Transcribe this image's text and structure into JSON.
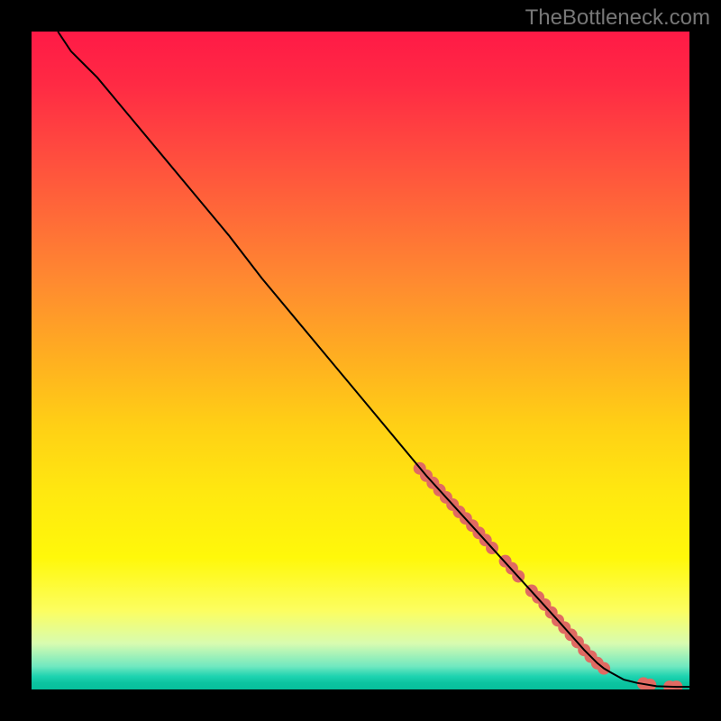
{
  "watermark": "TheBottleneck.com",
  "chart_data": {
    "type": "line",
    "title": "",
    "xlabel": "",
    "ylabel": "",
    "xlim": [
      0,
      100
    ],
    "ylim": [
      0,
      100
    ],
    "series": [
      {
        "name": "curve",
        "x": [
          4,
          6,
          8,
          10,
          15,
          20,
          25,
          30,
          35,
          40,
          45,
          50,
          55,
          60,
          65,
          70,
          75,
          80,
          84,
          86,
          87,
          88,
          90,
          92,
          95,
          98,
          100
        ],
        "values": [
          100,
          97,
          95,
          93,
          87,
          81,
          75,
          69,
          62.5,
          56.5,
          50.5,
          44.5,
          38.5,
          32.5,
          27,
          21.5,
          16,
          10.5,
          6,
          4,
          3.2,
          2.6,
          1.5,
          1,
          0.5,
          0.4,
          0.4
        ]
      }
    ],
    "markers": {
      "name": "highlighted-points",
      "color": "#e06a62",
      "x": [
        59,
        60,
        61,
        62,
        63,
        64,
        65,
        66,
        67,
        68,
        69,
        70,
        72,
        73,
        74,
        76,
        77,
        78,
        79,
        80,
        81,
        82,
        83,
        84,
        85,
        86,
        87,
        93,
        94,
        97,
        98
      ],
      "values": [
        33.6,
        32.5,
        31.4,
        30.3,
        29.2,
        28.1,
        27,
        26,
        24.9,
        23.8,
        22.7,
        21.5,
        19.5,
        18.4,
        17.2,
        15,
        14,
        12.9,
        11.7,
        10.5,
        9.4,
        8.3,
        7.2,
        6,
        5,
        4,
        3.2,
        0.9,
        0.7,
        0.4,
        0.4
      ]
    }
  }
}
